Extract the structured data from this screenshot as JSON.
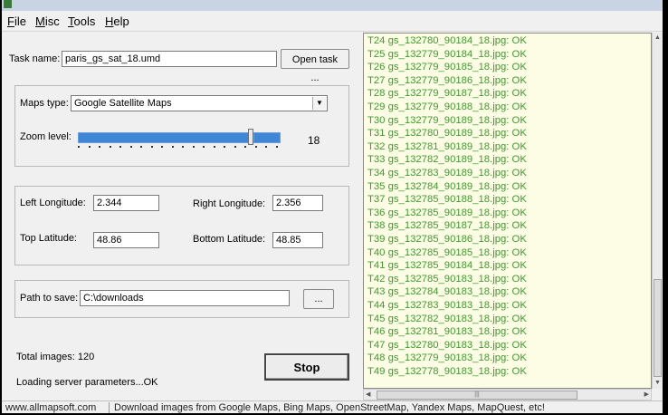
{
  "menu": {
    "file": "File",
    "misc": "Misc",
    "tools": "Tools",
    "help": "Help"
  },
  "task": {
    "label": "Task name:",
    "value": "paris_gs_sat_18.umd",
    "open_button": "Open task ..."
  },
  "maps": {
    "type_label": "Maps type:",
    "type_value": "Google Satellite Maps",
    "zoom_label": "Zoom level:",
    "zoom_value": "18",
    "zoom_level": 18
  },
  "coords": {
    "left_longitude_label": "Left Longitude:",
    "left_longitude": "2.344",
    "right_longitude_label": "Right Longitude:",
    "right_longitude": "2.356",
    "top_latitude_label": "Top Latitude:",
    "top_latitude": "48.86",
    "bottom_latitude_label": "Bottom Latitude:",
    "bottom_latitude": "48.85"
  },
  "path": {
    "label": "Path to save:",
    "value": "C:\\downloads",
    "browse_button": "..."
  },
  "totals": {
    "images_label": "Total images: 120",
    "status": "Loading server parameters...OK"
  },
  "stop_button": "Stop",
  "log_lines": [
    "T24 gs_132780_90184_18.jpg: OK",
    "T25 gs_132779_90184_18.jpg: OK",
    "T26 gs_132779_90185_18.jpg: OK",
    "T27 gs_132779_90186_18.jpg: OK",
    "T28 gs_132779_90187_18.jpg: OK",
    "T29 gs_132779_90188_18.jpg: OK",
    "T30 gs_132779_90189_18.jpg: OK",
    "T31 gs_132780_90189_18.jpg: OK",
    "T32 gs_132781_90189_18.jpg: OK",
    "T33 gs_132782_90189_18.jpg: OK",
    "T34 gs_132783_90189_18.jpg: OK",
    "T35 gs_132784_90189_18.jpg: OK",
    "T37 gs_132785_90188_18.jpg: OK",
    "T36 gs_132785_90189_18.jpg: OK",
    "T38 gs_132785_90187_18.jpg: OK",
    "T39 gs_132785_90186_18.jpg: OK",
    "T40 gs_132785_90185_18.jpg: OK",
    "T41 gs_132785_90184_18.jpg: OK",
    "T42 gs_132785_90183_18.jpg: OK",
    "T43 gs_132784_90183_18.jpg: OK",
    "T44 gs_132783_90183_18.jpg: OK",
    "T45 gs_132782_90183_18.jpg: OK",
    "T46 gs_132781_90183_18.jpg: OK",
    "T47 gs_132780_90183_18.jpg: OK",
    "T48 gs_132779_90183_18.jpg: OK",
    "T49 gs_132778_90183_18.jpg: OK"
  ],
  "statusbar": {
    "website": "www.allmapsoft.com",
    "message": "Download images from Google Maps, Bing Maps, OpenStreetMap, Yandex Maps, MapQuest, etc!"
  },
  "colors": {
    "log_text": "#3f9a2f",
    "log_background": "#fdfde5",
    "slider": "#3f86d6"
  }
}
